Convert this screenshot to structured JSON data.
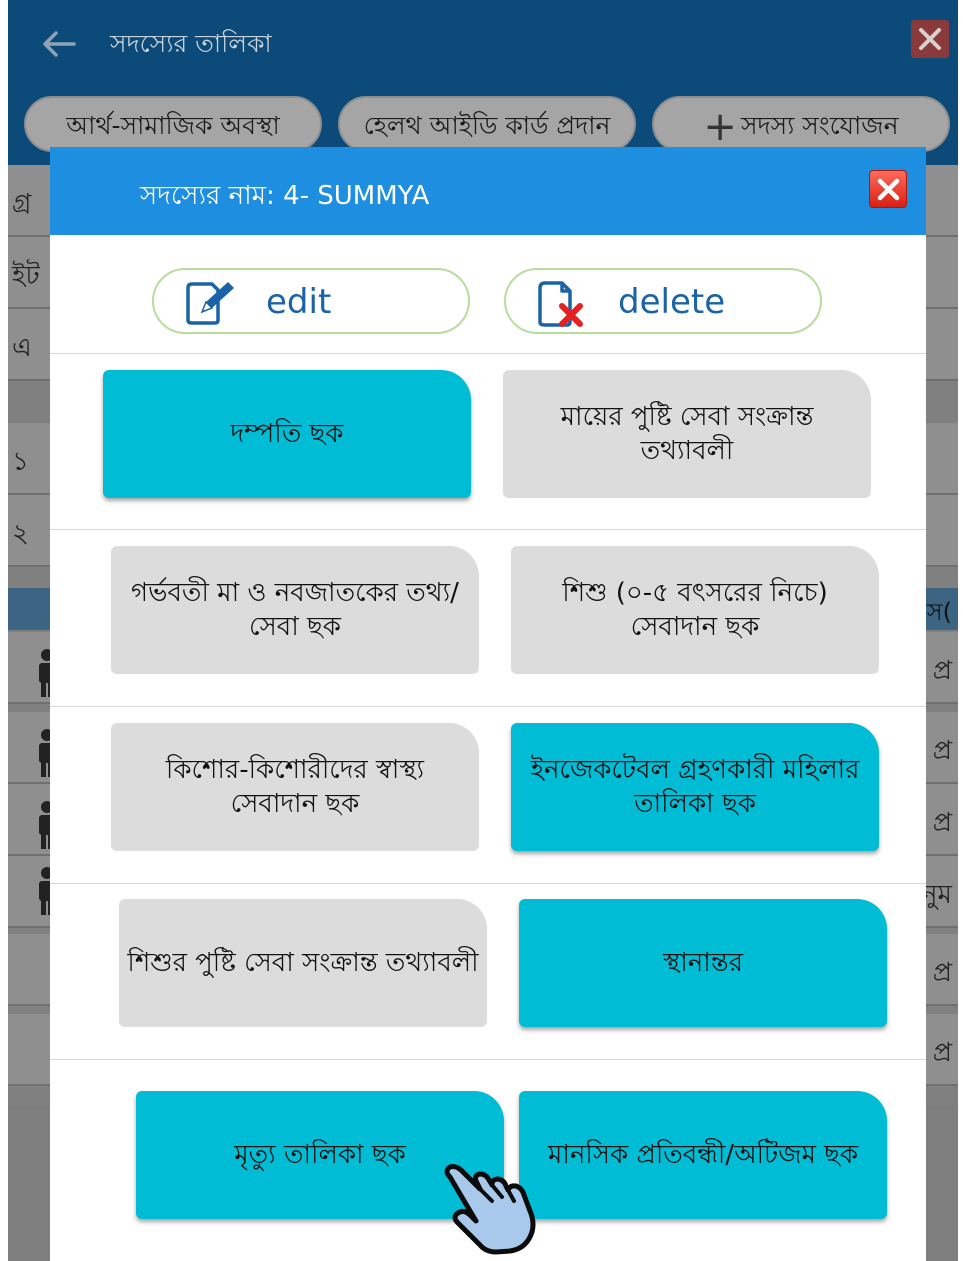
{
  "app": {
    "title": "সদস্যের তালিকা",
    "tabs": [
      {
        "label": "আর্থ-সামাজিক অবস্থা"
      },
      {
        "label": "হেলথ আইডি কার্ড প্রদান"
      },
      {
        "label": "সদস্য সংযোজন"
      }
    ],
    "bg_rows_left": [
      "গ্র",
      "ইট",
      "এ",
      "১",
      "২"
    ],
    "bg_rows_right": [
      "স(",
      "প্র",
      "প্র",
      "প্র",
      "ানুম",
      "প্র",
      "প্র"
    ]
  },
  "dialog": {
    "title": "সদস্যের নাম: 4- SUMMYA",
    "edit_label": "edit",
    "delete_label": "delete",
    "tiles": [
      {
        "label": "দম্পতি ছক",
        "style": "cyan"
      },
      {
        "label": "মায়ের পুষ্টি সেবা সংক্রান্ত তথ্যাবলী",
        "style": "grey"
      },
      {
        "label": "গর্ভবতী মা ও নবজাতকের তথ্য/সেবা ছক",
        "style": "grey"
      },
      {
        "label": "শিশু (০-৫ বৎসরের নিচে) সেবাদান ছক",
        "style": "grey"
      },
      {
        "label": "কিশোর-কিশোরীদের স্বাস্থ্য সেবাদান ছক",
        "style": "grey"
      },
      {
        "label": "ইনজেকটেবল গ্রহণকারী মহিলার তালিকা ছক",
        "style": "cyan"
      },
      {
        "label": "শিশুর পুষ্টি সেবা সংক্রান্ত তথ্যাবলী",
        "style": "grey"
      },
      {
        "label": "স্থানান্তর",
        "style": "cyan"
      },
      {
        "label": "মৃত্যু তালিকা ছক",
        "style": "cyan"
      },
      {
        "label": "মানসিক প্রতিবন্ধী/অটিজম ছক",
        "style": "cyan"
      }
    ]
  },
  "colors": {
    "header_blue": "#1e8ee0",
    "tile_cyan": "#00bcd4",
    "tile_grey": "#dcdcdc",
    "appbar_dim": "#0b4a79"
  },
  "icons": [
    "back-arrow-icon",
    "close-icon",
    "plus-icon",
    "edit-icon",
    "delete-file-icon",
    "person-icon",
    "pointer-hand-icon"
  ]
}
